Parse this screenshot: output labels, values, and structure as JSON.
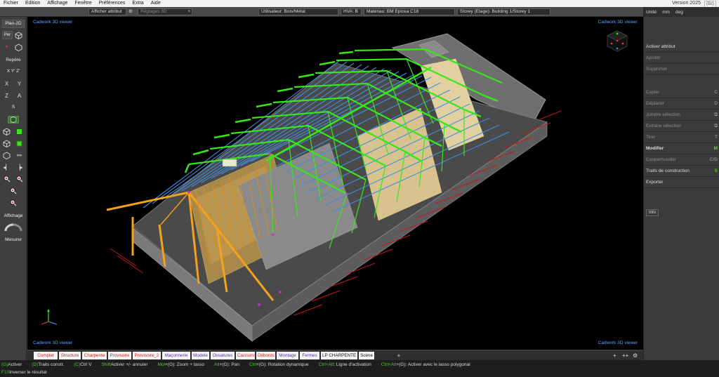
{
  "menu": [
    "Fichier",
    "Edition",
    "Affichage",
    "Fenêtre",
    "Préférences",
    "Extra",
    "Aide"
  ],
  "version": "Version 2025",
  "version_tag": "(Bit)",
  "toolbar": {
    "attr_button": "Afficher attribut",
    "settings_3d": "Réglages 3D",
    "user": "Utilisateur: Bois/Métal",
    "hva": "HVA: B",
    "material": "Matériau: BM Epicea C18",
    "storey": "Storey (Etage): Building 1/Storey 1"
  },
  "left_panel": {
    "plan2d": "Plan-2D",
    "per": "Per",
    "repere": "Repère",
    "xyz": "X Y' Z'",
    "x": "X",
    "y": "Y",
    "z": "Z",
    "a": "A",
    "s": "S",
    "affichage": "Affichage",
    "mesurer": "Mesurer"
  },
  "viewport": {
    "label_tl": "Cadwork 3D viewer",
    "label_tr": "Cadwork 3D viewer",
    "label_bl": "Cadwork 3D viewer",
    "label_br": "Cadwork 3D viewer"
  },
  "right_panel": {
    "units": [
      "Unité",
      "mm",
      "deg"
    ],
    "items": [
      {
        "label": "Activer attribut",
        "shortcut": "",
        "dim": false
      },
      {
        "label": "Ajouter",
        "shortcut": "",
        "dim": true
      },
      {
        "label": "Supprimer",
        "shortcut": "",
        "dim": true
      },
      {
        "label": "Copier",
        "shortcut": "C",
        "dim": true
      },
      {
        "label": "Déplacer",
        "shortcut": "D",
        "dim": true
      },
      {
        "label": "Joindre sélection",
        "shortcut": "",
        "dim": true
      },
      {
        "label": "Extraire sélection",
        "shortcut": "",
        "dim": true
      },
      {
        "label": "Tirer",
        "shortcut": "T",
        "dim": true
      },
      {
        "label": "Modifier",
        "shortcut": "M",
        "dim": false
      },
      {
        "label": "Couper/souder",
        "shortcut": "C/D",
        "dim": true
      },
      {
        "label": "Traits de construction",
        "shortcut": "B",
        "dim": false
      },
      {
        "label": "Exporter",
        "shortcut": "",
        "dim": false
      }
    ],
    "info": "Info"
  },
  "tabs": [
    {
      "label": "Complet",
      "color": "#d12020"
    },
    {
      "label": "Structure",
      "color": "#d12020"
    },
    {
      "label": "Charpente",
      "color": "#d12020"
    },
    {
      "label": "Provisoire",
      "color": "#d12020"
    },
    {
      "label": "Provisoire_2",
      "color": "#d12020"
    },
    {
      "label": "Maçonnerie",
      "color": "#5a2fa8"
    },
    {
      "label": "Modele",
      "color": "#5a2fa8"
    },
    {
      "label": "Ossatures",
      "color": "#5a2fa8"
    },
    {
      "label": "Caissons",
      "color": "#d12020"
    },
    {
      "label": "Débords",
      "color": "#d12020"
    },
    {
      "label": "Montage",
      "color": "#5a2fa8"
    },
    {
      "label": "Fermes",
      "color": "#5a2fa8"
    },
    {
      "label": "LP CHARPENTE",
      "color": "#111111"
    },
    {
      "label": "Scène",
      "color": "#111111"
    }
  ],
  "tabbar_right": [
    "+",
    "++",
    "⚙"
  ],
  "status": {
    "row1": [
      {
        "key": "(G)",
        "text": " Activer"
      },
      {
        "key": "(D)",
        "text": " Traits constr."
      },
      {
        "key": "(C)",
        "text": " Ctrl V"
      },
      {
        "key": "Shift",
        "text": " Activer +/- annuler"
      },
      {
        "key": "Mol",
        "text": "+(G): Zoom + lasso"
      },
      {
        "key": "Alt",
        "text": "+(G): Pan"
      },
      {
        "key": "Ctrl",
        "text": "+(G): Rotation dynamique"
      },
      {
        "key": "Ctrl+Alt",
        "text": " : Ligne d'activation"
      },
      {
        "key": "Ctrl+Alt",
        "text": "+(G): Activer avec le lasso polygonal"
      }
    ],
    "row2": [
      {
        "key": "F10",
        "text": " Inverser le résultat"
      }
    ]
  },
  "colors": {
    "truss_green": "#39e61a",
    "purlin_blue": "#3f8ee0",
    "glulam_orange": "#f5a21a",
    "wall_grey": "#8a8a8a",
    "dimension_red": "#c41a1a",
    "viewer_label_blue": "#5da1ff"
  }
}
